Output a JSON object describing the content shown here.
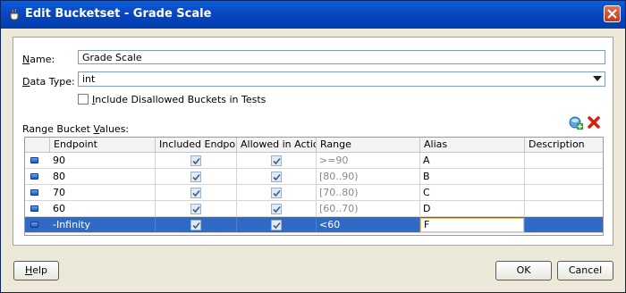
{
  "window": {
    "title": "Edit Bucketset - Grade Scale"
  },
  "form": {
    "name_label_prefix": "N",
    "name_label_rest": "ame:",
    "name_value": "Grade Scale",
    "datatype_label_prefix": "D",
    "datatype_label_rest": "ata Type:",
    "datatype_value": "int",
    "include_disallowed_label_prefix": "I",
    "include_disallowed_label_rest": "nclude Disallowed Buckets in Tests",
    "include_disallowed_checked": false,
    "range_values_label_a": "Range Bucket ",
    "range_values_label_u": "V",
    "range_values_label_b": "alues:"
  },
  "table": {
    "columns": [
      "Endpoint",
      "Included Endpoint",
      "Allowed in Actions",
      "Range",
      "Alias",
      "Description"
    ],
    "rows": [
      {
        "endpoint": "90",
        "included": true,
        "allowed": true,
        "range": ">=90",
        "alias": "A",
        "description": "",
        "selected": false
      },
      {
        "endpoint": "80",
        "included": true,
        "allowed": true,
        "range": "[80..90)",
        "alias": "B",
        "description": "",
        "selected": false
      },
      {
        "endpoint": "70",
        "included": true,
        "allowed": true,
        "range": "[70..80)",
        "alias": "C",
        "description": "",
        "selected": false
      },
      {
        "endpoint": "60",
        "included": true,
        "allowed": true,
        "range": "[60..70)",
        "alias": "D",
        "description": "",
        "selected": false
      },
      {
        "endpoint": "-Infinity",
        "included": true,
        "allowed": true,
        "range": "<60",
        "alias": "F",
        "description": "",
        "selected": true
      }
    ]
  },
  "buttons": {
    "help_prefix": "H",
    "help_rest": "elp",
    "ok": "OK",
    "cancel": "Cancel"
  },
  "colors": {
    "titlebar": "#0a46c0",
    "selection": "#316ac5",
    "delete_icon": "#d8200f"
  }
}
